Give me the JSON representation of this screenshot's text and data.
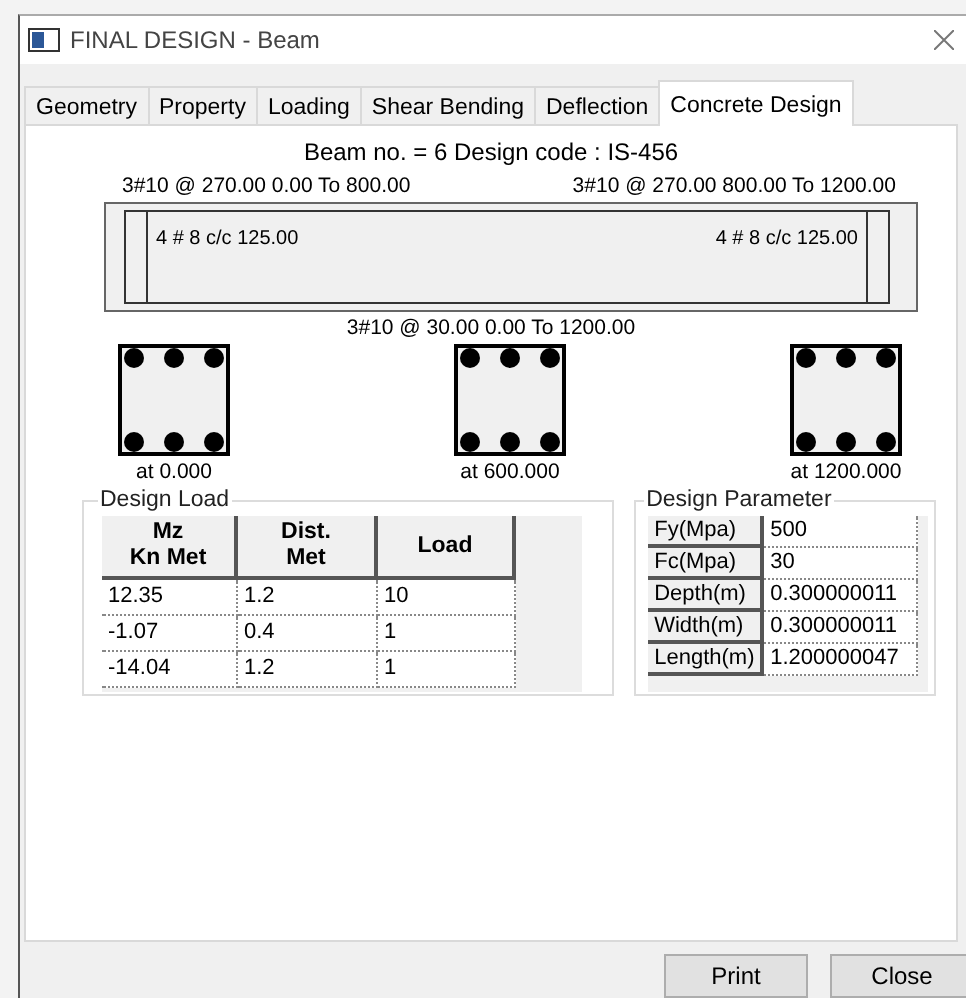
{
  "window": {
    "title": "FINAL DESIGN - Beam"
  },
  "tabs": [
    {
      "label": "Geometry",
      "selected": false
    },
    {
      "label": "Property",
      "selected": false
    },
    {
      "label": "Loading",
      "selected": false
    },
    {
      "label": "Shear Bending",
      "selected": false
    },
    {
      "label": "Deflection",
      "selected": false
    },
    {
      "label": "Concrete Design",
      "selected": true
    }
  ],
  "heading": "Beam no. = 6  Design code :  IS-456",
  "beam": {
    "top_labels": [
      "3#10 @ 270.00 0.00 To 800.00",
      "3#10 @ 270.00 800.00 To 1200.00"
    ],
    "stirrup_labels": [
      "4 # 8 c/c 125.00",
      "4 # 8 c/c 125.00"
    ],
    "bottom_label": "3#10 @ 30.00 0.00 To 1200.00"
  },
  "sections": [
    {
      "label": "at 0.000"
    },
    {
      "label": "at 600.000"
    },
    {
      "label": "at 1200.000"
    }
  ],
  "design_load": {
    "title": "Design Load",
    "columns": [
      "Mz\nKn Met",
      "Dist.\nMet",
      "Load"
    ],
    "rows": [
      [
        "12.35",
        "1.2",
        "10"
      ],
      [
        "-1.07",
        "0.4",
        "1"
      ],
      [
        "-14.04",
        "1.2",
        "1"
      ]
    ]
  },
  "design_parameter": {
    "title": "Design Parameter",
    "rows": [
      {
        "name": "Fy(Mpa)",
        "value": "500"
      },
      {
        "name": "Fc(Mpa)",
        "value": "30"
      },
      {
        "name": "Depth(m)",
        "value": "0.300000011"
      },
      {
        "name": "Width(m)",
        "value": "0.300000011"
      },
      {
        "name": "Length(m)",
        "value": "1.200000047"
      }
    ]
  },
  "buttons": [
    "Print",
    "Close"
  ]
}
